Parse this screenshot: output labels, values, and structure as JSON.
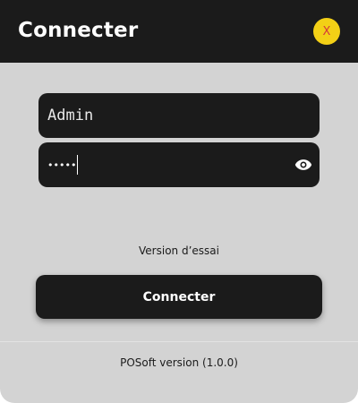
{
  "window": {
    "title": "Connecter",
    "close_label": "X",
    "close_icon": "close-icon"
  },
  "form": {
    "username_value": "Admin",
    "password_masked": "•••••",
    "password_toggle_icon": "eye-icon"
  },
  "trial_text": "Version d’essai",
  "connect_label": "Connecter",
  "footer_version": "POSoft version (1.0.0)",
  "colors": {
    "header_bg": "#1b1b1b",
    "window_bg": "#d3d3d3",
    "close_button_bg": "#f3d016",
    "close_button_text": "#d53a3a"
  }
}
